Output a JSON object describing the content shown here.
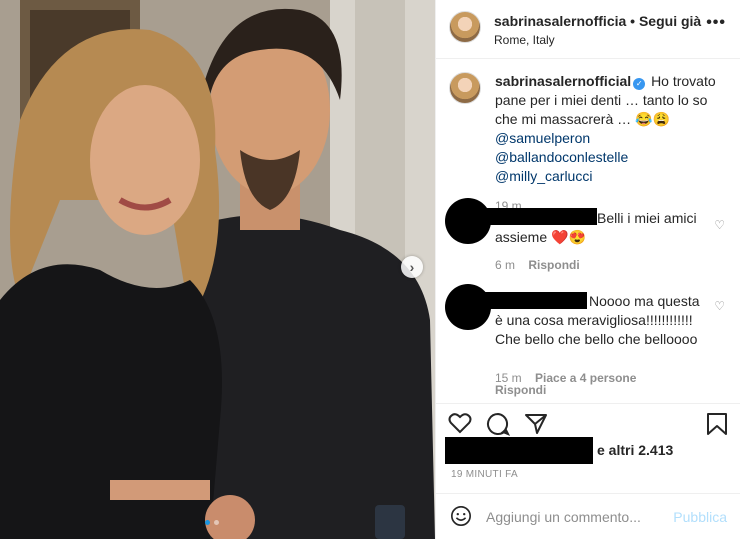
{
  "header": {
    "username": "sabrinasalernofficia",
    "separator": "•",
    "follow_label": "Segui già",
    "location": "Rome, Italy",
    "more": "•••"
  },
  "caption": {
    "username": "sabrinasalernofficial",
    "text": "Ho trovato pane per i miei denti … tanto lo so che mi massacrerà … 😂😩",
    "mentions": "@samuelperon @ballandoconlestelle @milly_carlucci",
    "time": "19 m"
  },
  "comments": [
    {
      "text": "Belli i miei amici assieme ❤️😍",
      "time": "6 m",
      "reply_label": "Rispondi"
    },
    {
      "text": "Noooo ma questa è una cosa meravigliosa!!!!!!!!!!!! Che bello che bello che belloooo",
      "time": "15 m",
      "likes_label": "Piace a 4 persone",
      "reply_label": "Rispondi"
    }
  ],
  "likes_text": "e altri 2.413",
  "timestamp": "19 MINUTI FA",
  "comment_input": {
    "placeholder": "Aggiungi un commento...",
    "publish_label": "Pubblica"
  },
  "photo": {
    "carousel_next": "›"
  },
  "colors": {
    "link": "#00376b",
    "verified": "#3897f0",
    "publish_disabled": "#b2dffc",
    "carousel_active_dot": "#1b95e0"
  }
}
